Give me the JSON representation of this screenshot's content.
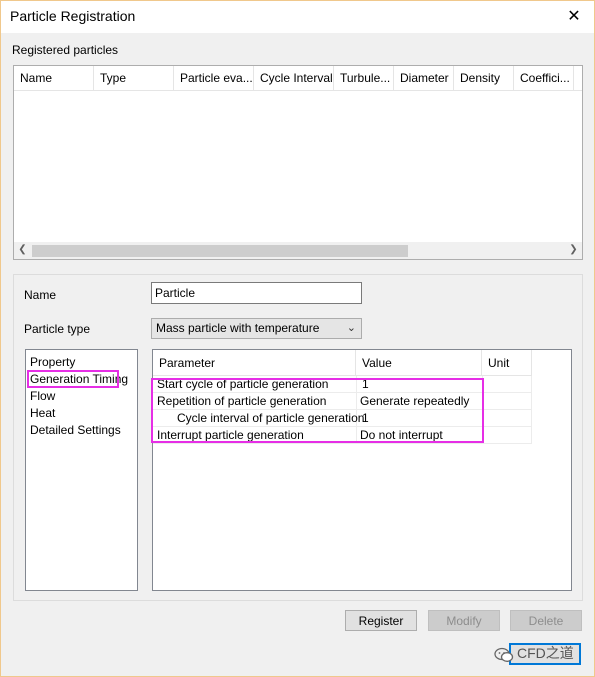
{
  "window": {
    "title": "Particle Registration"
  },
  "registered": {
    "label": "Registered particles",
    "columns": [
      "Name",
      "Type",
      "Particle eva...",
      "Cycle Interval",
      "Turbule...",
      "Diameter",
      "Density",
      "Coeffici..."
    ]
  },
  "form": {
    "name_label": "Name",
    "name_value": "Particle",
    "type_label": "Particle type",
    "type_value": "Mass particle with temperature"
  },
  "nav": {
    "items": [
      "Property",
      "Generation Timing",
      "Flow",
      "Heat",
      "Detailed Settings"
    ],
    "selected": "Generation Timing"
  },
  "grid": {
    "headers": [
      "Parameter",
      "Value",
      "Unit"
    ],
    "rows": [
      {
        "parameter": "Start cycle of particle generation",
        "value": "1",
        "unit": ""
      },
      {
        "parameter": "Repetition of particle generation",
        "value": "Generate repeatedly",
        "unit": ""
      },
      {
        "parameter": "Cycle interval of particle generation",
        "value": "1",
        "unit": ""
      },
      {
        "parameter": "Interrupt particle generation",
        "value": "Do not interrupt",
        "unit": ""
      }
    ]
  },
  "buttons": {
    "register": "Register",
    "modify": "Modify",
    "delete": "Delete"
  },
  "watermark": {
    "text": "CFD之道"
  },
  "colors": {
    "annotation": "#e62ee6",
    "focus": "#0078d7"
  }
}
